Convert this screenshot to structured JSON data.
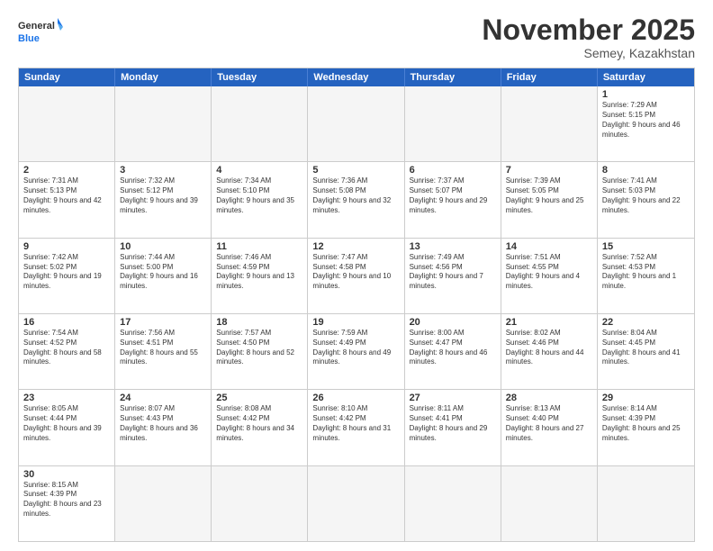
{
  "logo": {
    "general": "General",
    "blue": "Blue"
  },
  "title": "November 2025",
  "subtitle": "Semey, Kazakhstan",
  "header_days": [
    "Sunday",
    "Monday",
    "Tuesday",
    "Wednesday",
    "Thursday",
    "Friday",
    "Saturday"
  ],
  "weeks": [
    [
      {
        "day": "",
        "empty": true,
        "info": ""
      },
      {
        "day": "",
        "empty": true,
        "info": ""
      },
      {
        "day": "",
        "empty": true,
        "info": ""
      },
      {
        "day": "",
        "empty": true,
        "info": ""
      },
      {
        "day": "",
        "empty": true,
        "info": ""
      },
      {
        "day": "",
        "empty": true,
        "info": ""
      },
      {
        "day": "1",
        "empty": false,
        "info": "Sunrise: 7:29 AM\nSunset: 5:15 PM\nDaylight: 9 hours and 46 minutes."
      }
    ],
    [
      {
        "day": "2",
        "empty": false,
        "info": "Sunrise: 7:31 AM\nSunset: 5:13 PM\nDaylight: 9 hours and 42 minutes."
      },
      {
        "day": "3",
        "empty": false,
        "info": "Sunrise: 7:32 AM\nSunset: 5:12 PM\nDaylight: 9 hours and 39 minutes."
      },
      {
        "day": "4",
        "empty": false,
        "info": "Sunrise: 7:34 AM\nSunset: 5:10 PM\nDaylight: 9 hours and 35 minutes."
      },
      {
        "day": "5",
        "empty": false,
        "info": "Sunrise: 7:36 AM\nSunset: 5:08 PM\nDaylight: 9 hours and 32 minutes."
      },
      {
        "day": "6",
        "empty": false,
        "info": "Sunrise: 7:37 AM\nSunset: 5:07 PM\nDaylight: 9 hours and 29 minutes."
      },
      {
        "day": "7",
        "empty": false,
        "info": "Sunrise: 7:39 AM\nSunset: 5:05 PM\nDaylight: 9 hours and 25 minutes."
      },
      {
        "day": "8",
        "empty": false,
        "info": "Sunrise: 7:41 AM\nSunset: 5:03 PM\nDaylight: 9 hours and 22 minutes."
      }
    ],
    [
      {
        "day": "9",
        "empty": false,
        "info": "Sunrise: 7:42 AM\nSunset: 5:02 PM\nDaylight: 9 hours and 19 minutes."
      },
      {
        "day": "10",
        "empty": false,
        "info": "Sunrise: 7:44 AM\nSunset: 5:00 PM\nDaylight: 9 hours and 16 minutes."
      },
      {
        "day": "11",
        "empty": false,
        "info": "Sunrise: 7:46 AM\nSunset: 4:59 PM\nDaylight: 9 hours and 13 minutes."
      },
      {
        "day": "12",
        "empty": false,
        "info": "Sunrise: 7:47 AM\nSunset: 4:58 PM\nDaylight: 9 hours and 10 minutes."
      },
      {
        "day": "13",
        "empty": false,
        "info": "Sunrise: 7:49 AM\nSunset: 4:56 PM\nDaylight: 9 hours and 7 minutes."
      },
      {
        "day": "14",
        "empty": false,
        "info": "Sunrise: 7:51 AM\nSunset: 4:55 PM\nDaylight: 9 hours and 4 minutes."
      },
      {
        "day": "15",
        "empty": false,
        "info": "Sunrise: 7:52 AM\nSunset: 4:53 PM\nDaylight: 9 hours and 1 minute."
      }
    ],
    [
      {
        "day": "16",
        "empty": false,
        "info": "Sunrise: 7:54 AM\nSunset: 4:52 PM\nDaylight: 8 hours and 58 minutes."
      },
      {
        "day": "17",
        "empty": false,
        "info": "Sunrise: 7:56 AM\nSunset: 4:51 PM\nDaylight: 8 hours and 55 minutes."
      },
      {
        "day": "18",
        "empty": false,
        "info": "Sunrise: 7:57 AM\nSunset: 4:50 PM\nDaylight: 8 hours and 52 minutes."
      },
      {
        "day": "19",
        "empty": false,
        "info": "Sunrise: 7:59 AM\nSunset: 4:49 PM\nDaylight: 8 hours and 49 minutes."
      },
      {
        "day": "20",
        "empty": false,
        "info": "Sunrise: 8:00 AM\nSunset: 4:47 PM\nDaylight: 8 hours and 46 minutes."
      },
      {
        "day": "21",
        "empty": false,
        "info": "Sunrise: 8:02 AM\nSunset: 4:46 PM\nDaylight: 8 hours and 44 minutes."
      },
      {
        "day": "22",
        "empty": false,
        "info": "Sunrise: 8:04 AM\nSunset: 4:45 PM\nDaylight: 8 hours and 41 minutes."
      }
    ],
    [
      {
        "day": "23",
        "empty": false,
        "info": "Sunrise: 8:05 AM\nSunset: 4:44 PM\nDaylight: 8 hours and 39 minutes."
      },
      {
        "day": "24",
        "empty": false,
        "info": "Sunrise: 8:07 AM\nSunset: 4:43 PM\nDaylight: 8 hours and 36 minutes."
      },
      {
        "day": "25",
        "empty": false,
        "info": "Sunrise: 8:08 AM\nSunset: 4:42 PM\nDaylight: 8 hours and 34 minutes."
      },
      {
        "day": "26",
        "empty": false,
        "info": "Sunrise: 8:10 AM\nSunset: 4:42 PM\nDaylight: 8 hours and 31 minutes."
      },
      {
        "day": "27",
        "empty": false,
        "info": "Sunrise: 8:11 AM\nSunset: 4:41 PM\nDaylight: 8 hours and 29 minutes."
      },
      {
        "day": "28",
        "empty": false,
        "info": "Sunrise: 8:13 AM\nSunset: 4:40 PM\nDaylight: 8 hours and 27 minutes."
      },
      {
        "day": "29",
        "empty": false,
        "info": "Sunrise: 8:14 AM\nSunset: 4:39 PM\nDaylight: 8 hours and 25 minutes."
      }
    ],
    [
      {
        "day": "30",
        "empty": false,
        "info": "Sunrise: 8:15 AM\nSunset: 4:39 PM\nDaylight: 8 hours and 23 minutes."
      },
      {
        "day": "",
        "empty": true,
        "info": ""
      },
      {
        "day": "",
        "empty": true,
        "info": ""
      },
      {
        "day": "",
        "empty": true,
        "info": ""
      },
      {
        "day": "",
        "empty": true,
        "info": ""
      },
      {
        "day": "",
        "empty": true,
        "info": ""
      },
      {
        "day": "",
        "empty": true,
        "info": ""
      }
    ]
  ]
}
